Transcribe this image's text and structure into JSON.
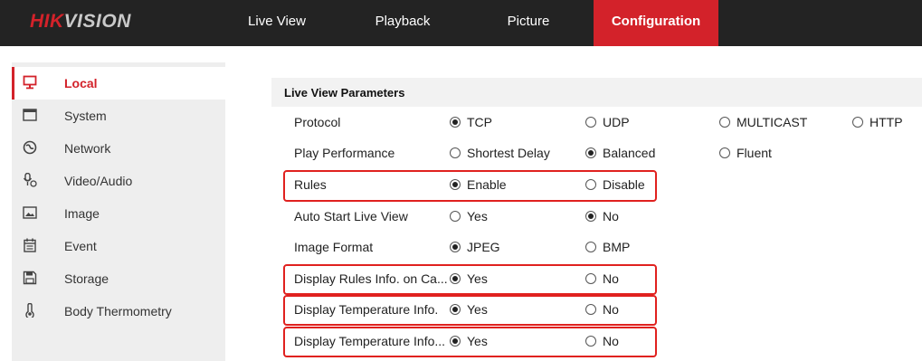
{
  "logo": {
    "hik": "HIK",
    "vision": "VISION"
  },
  "nav": [
    {
      "label": "Live View",
      "active": false
    },
    {
      "label": "Playback",
      "active": false
    },
    {
      "label": "Picture",
      "active": false
    },
    {
      "label": "Configuration",
      "active": true
    }
  ],
  "sidebar": {
    "items": [
      {
        "label": "Local",
        "icon": "monitor-icon",
        "active": true
      },
      {
        "label": "System",
        "icon": "system-window-icon",
        "active": false
      },
      {
        "label": "Network",
        "icon": "globe-icon",
        "active": false
      },
      {
        "label": "Video/Audio",
        "icon": "microphone-camera-icon",
        "active": false
      },
      {
        "label": "Image",
        "icon": "image-icon",
        "active": false
      },
      {
        "label": "Event",
        "icon": "calendar-icon",
        "active": false
      },
      {
        "label": "Storage",
        "icon": "floppy-disk-icon",
        "active": false
      },
      {
        "label": "Body Thermometry",
        "icon": "thermometer-icon",
        "active": false
      }
    ]
  },
  "section": {
    "title": "Live View Parameters"
  },
  "rows": [
    {
      "label": "Protocol",
      "options": [
        "TCP",
        "UDP",
        "MULTICAST",
        "HTTP"
      ],
      "selected": "TCP"
    },
    {
      "label": "Play Performance",
      "options": [
        "Shortest Delay",
        "Balanced",
        "Fluent"
      ],
      "selected": "Balanced"
    },
    {
      "label": "Rules",
      "options": [
        "Enable",
        "Disable"
      ],
      "selected": "Enable"
    },
    {
      "label": "Auto Start Live View",
      "options": [
        "Yes",
        "No"
      ],
      "selected": "No"
    },
    {
      "label": "Image Format",
      "options": [
        "JPEG",
        "BMP"
      ],
      "selected": "JPEG"
    },
    {
      "label": "Display Rules Info. on Ca...",
      "options": [
        "Yes",
        "No"
      ],
      "selected": "Yes"
    },
    {
      "label": "Display Temperature Info.",
      "options": [
        "Yes",
        "No"
      ],
      "selected": "Yes"
    },
    {
      "label": "Display Temperature Info...",
      "options": [
        "Yes",
        "No"
      ],
      "selected": "Yes"
    }
  ],
  "colors": {
    "accent": "#d3222a",
    "highlight": "#e0211f",
    "topbar": "#232323",
    "sidebar": "#eeeeee"
  }
}
